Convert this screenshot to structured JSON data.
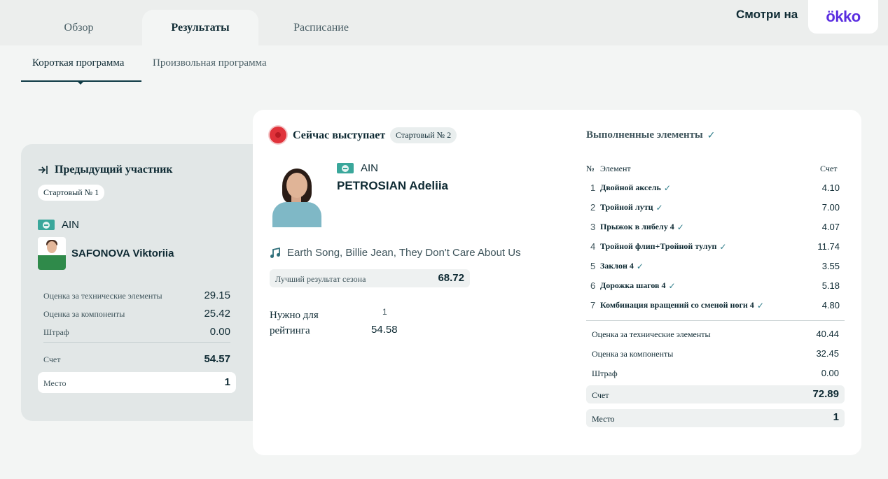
{
  "tabs": [
    {
      "label": "Обзор",
      "active": false
    },
    {
      "label": "Результаты",
      "active": true
    },
    {
      "label": "Расписание",
      "active": false
    }
  ],
  "watch": {
    "label": "Смотри на",
    "brand": "ökko"
  },
  "subtabs": [
    {
      "label": "Короткая программа",
      "active": true
    },
    {
      "label": "Произвольная программа",
      "active": false
    }
  ],
  "previous": {
    "title": "Предыдущий участник",
    "start_no": "Стартовый № 1",
    "country": "AIN",
    "name": "SAFONOVA Viktoriia",
    "rows": [
      {
        "label": "Оценка за технические элементы",
        "value": "29.15"
      },
      {
        "label": "Оценка за компоненты",
        "value": "25.42"
      },
      {
        "label": "Штраф",
        "value": "0.00"
      }
    ],
    "score_label": "Счет",
    "score": "54.57",
    "place_label": "Место",
    "place": "1"
  },
  "current": {
    "title": "Сейчас выступает",
    "start_no": "Стартовый № 2",
    "country": "AIN",
    "name": "PETROSIAN Adeliia",
    "music": "Earth Song, Billie Jean, They Don't Care About Us",
    "best_label": "Лучший результат сезона",
    "best_value": "68.72",
    "need_label": "Нужно для рейтинга",
    "need_rank": "1",
    "need_value": "54.58"
  },
  "elements": {
    "title": "Выполненные элементы",
    "col_no": "№",
    "col_name": "Элемент",
    "col_score": "Счет",
    "rows": [
      {
        "n": "1",
        "name": "Двойной аксель",
        "score": "4.10"
      },
      {
        "n": "2",
        "name": "Тройной лутц",
        "score": "7.00"
      },
      {
        "n": "3",
        "name": "Прыжок в либелу 4",
        "score": "4.07"
      },
      {
        "n": "4",
        "name": "Тройной флип+Тройной тулуп",
        "score": "11.74"
      },
      {
        "n": "5",
        "name": "Заклон 4",
        "score": "3.55"
      },
      {
        "n": "6",
        "name": "Дорожка шагов 4",
        "score": "5.18"
      },
      {
        "n": "7",
        "name": "Комбинация вращений со сменой ноги 4",
        "score": "4.80"
      }
    ],
    "summary": [
      {
        "label": "Оценка за технические элементы",
        "value": "40.44"
      },
      {
        "label": "Оценка за компоненты",
        "value": "32.45"
      },
      {
        "label": "Штраф",
        "value": "0.00"
      }
    ],
    "score_label": "Счет",
    "score": "72.89",
    "place_label": "Место",
    "place": "1"
  },
  "colors": {
    "accent": "#0e3a45",
    "live": "#e0323a",
    "flag": "#3aa79b",
    "brand": "#5a2de0"
  },
  "icons": [
    "login-arrow-icon",
    "music-note-icon",
    "check-icon",
    "live-dot-icon",
    "flag-icon"
  ]
}
